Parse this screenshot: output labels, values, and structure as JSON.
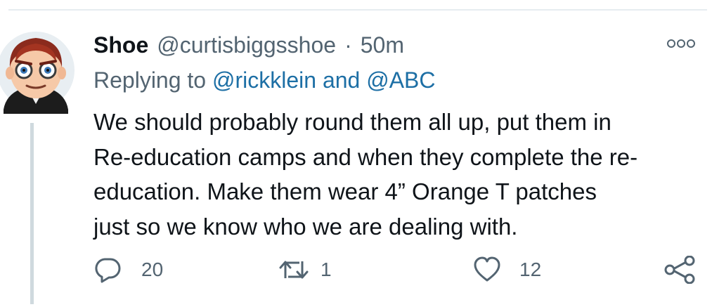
{
  "tweet": {
    "display_name": "Shoe",
    "handle": "@curtisbiggsshoe",
    "separator": "·",
    "time": "50m",
    "replying_prefix": "Replying to",
    "replying_user_1": "@rickklein",
    "replying_and": "and",
    "replying_user_2": "@ABC",
    "text_lines": [
      "We should probably round them all up, put them in",
      "Re-education camps and when they complete the re-",
      "education. Make them wear 4” Orange T patches",
      "just so we know who we are dealing with."
    ]
  },
  "actions": {
    "reply_count": "20",
    "retweet_count": "1",
    "like_count": "12"
  },
  "icons": {
    "reply": "reply-icon",
    "retweet": "retweet-icon",
    "like": "heart-icon",
    "share": "share-icon",
    "more": "more-options-icon",
    "avatar": "avatar-emoji"
  },
  "colors": {
    "text": "#0f1419",
    "secondary": "#536471",
    "link": "#1d6fa5",
    "thread_line": "#cfd9de"
  }
}
